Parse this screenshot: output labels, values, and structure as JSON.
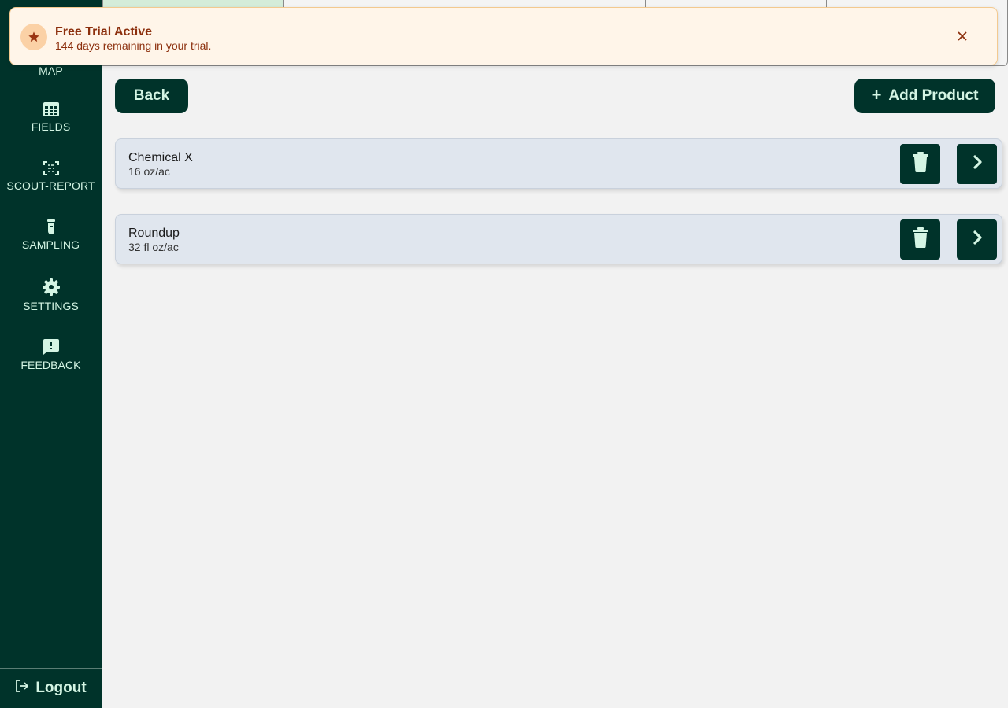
{
  "sidebar": {
    "items": [
      {
        "label": "MAP",
        "icon": "map-icon"
      },
      {
        "label": "FIELDS",
        "icon": "grid-icon"
      },
      {
        "label": "SCOUT-REPORT",
        "icon": "scan-icon"
      },
      {
        "label": "SAMPLING",
        "icon": "test-tube-icon"
      },
      {
        "label": "SETTINGS",
        "icon": "gear-icon"
      },
      {
        "label": "FEEDBACK",
        "icon": "feedback-icon"
      }
    ],
    "logout_label": "Logout"
  },
  "trial_banner": {
    "title": "Free Trial Active",
    "message": "144 days remaining in your trial.",
    "icon": "star-icon"
  },
  "toolbar": {
    "back_label": "Back",
    "add_label": "Add Product",
    "add_icon": "+"
  },
  "products": [
    {
      "name": "Chemical X",
      "rate": "16 oz/ac"
    },
    {
      "name": "Roundup",
      "rate": "32 fl oz/ac"
    }
  ],
  "colors": {
    "sidebar_bg": "#00332a",
    "accent_text": "#d4f5e4",
    "banner_bg": "#fff5e9",
    "banner_text": "#8c2f0d",
    "row_bg": "#e0e6ee"
  }
}
